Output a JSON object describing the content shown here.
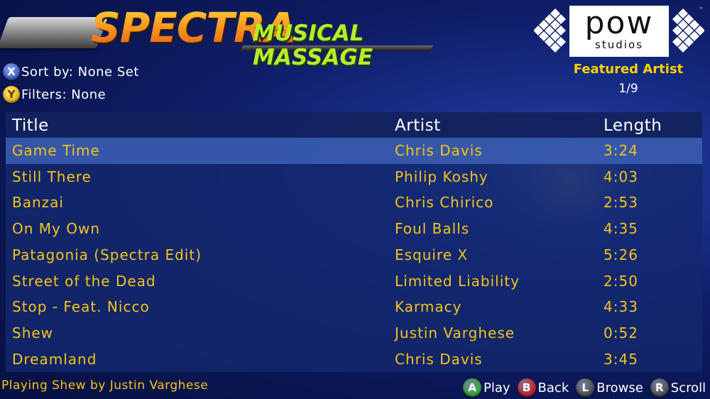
{
  "header": {
    "logo_main": "SPECTRA",
    "logo_sub": "MUSICAL MASSAGE",
    "publisher_main": "pow",
    "publisher_sub": "studios",
    "publisher_tm": "™"
  },
  "controls": {
    "sort": {
      "button": "X",
      "label": "Sort by: None Set",
      "color": "#3a5bc7"
    },
    "filter": {
      "button": "Y",
      "label": "Filters: None",
      "color": "#e8b800"
    }
  },
  "featured": {
    "label": "Featured Artist",
    "page": "1/9"
  },
  "table": {
    "headers": {
      "title": "Title",
      "artist": "Artist",
      "length": "Length"
    },
    "rows": [
      {
        "title": "Game Time",
        "artist": "Chris Davis",
        "length": "3:24",
        "selected": true
      },
      {
        "title": "Still There",
        "artist": "Philip Koshy",
        "length": "4:03"
      },
      {
        "title": "Banzai",
        "artist": "Chris Chirico",
        "length": "2:53"
      },
      {
        "title": "On My Own",
        "artist": "Foul Balls",
        "length": "4:35"
      },
      {
        "title": "Patagonia (Spectra Edit)",
        "artist": "Esquire X",
        "length": "5:26"
      },
      {
        "title": "Street of the Dead",
        "artist": "Limited Liability",
        "length": "2:50"
      },
      {
        "title": "Stop - Feat. Nicco",
        "artist": "Karmacy",
        "length": "4:33"
      },
      {
        "title": "Shew",
        "artist": "Justin Varghese",
        "length": "0:52"
      },
      {
        "title": "Dreamland",
        "artist": "Chris Davis",
        "length": "3:45"
      }
    ]
  },
  "footer": {
    "now_playing": "Playing Shew by Justin Varghese",
    "hints": [
      {
        "button": "A",
        "label": "Play",
        "color": "#3aa83a",
        "icon": "a-button-icon"
      },
      {
        "button": "B",
        "label": "Back",
        "color": "#c8252b",
        "icon": "b-button-icon"
      },
      {
        "button": "L",
        "label": "Browse",
        "color": "#555555",
        "icon": "left-stick-icon"
      },
      {
        "button": "R",
        "label": "Scroll",
        "color": "#555555",
        "icon": "right-stick-icon"
      }
    ]
  },
  "colors": {
    "accent_text": "#f5c518",
    "featured_label": "#ffd300",
    "selected_row": "#3c5fb4"
  }
}
